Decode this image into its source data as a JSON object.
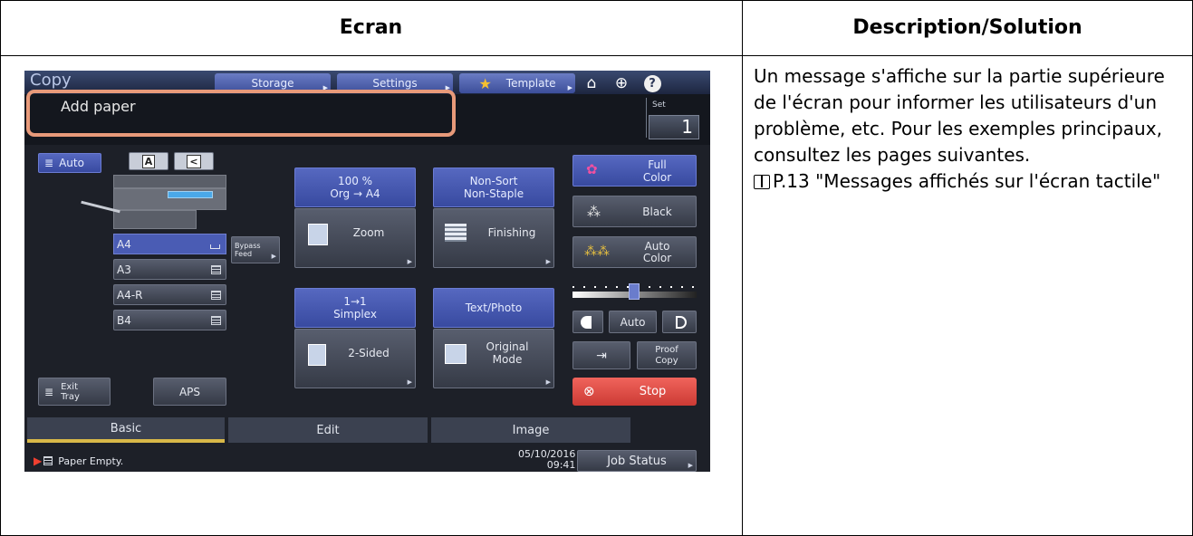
{
  "table": {
    "header_screen": "Ecran",
    "header_description": "Description/Solution",
    "description": "Un message s'affiche sur la partie supérieure de l'écran pour informer les utilisateurs d'un problème, etc. Pour les exemples principaux, consultez les pages suivantes.",
    "reference": "P.13 \"Messages affichés sur l'écran tactile\""
  },
  "screen": {
    "app_title": "Copy",
    "top_buttons": [
      "Storage",
      "Settings",
      "Template"
    ],
    "message": "Add paper",
    "set_label": "Set",
    "set_value": "1",
    "left": {
      "auto_label": "Auto",
      "trays": [
        "A4",
        "A3",
        "A4-R",
        "B4"
      ],
      "bypass_line1": "Bypass",
      "bypass_line2": "Feed",
      "exit_tray_line1": "Exit",
      "exit_tray_line2": "Tray",
      "aps": "APS"
    },
    "center": {
      "zoom_info_line1": "100 %",
      "zoom_info_line2": "Org  →   A4",
      "zoom": "Zoom",
      "finishing_info_line1": "Non-Sort",
      "finishing_info_line2": "Non-Staple",
      "finishing": "Finishing",
      "duplex_info_line1": "1→1",
      "duplex_info_line2": "Simplex",
      "two_sided": "2-Sided",
      "mode_info": "Text/Photo",
      "original_mode_line1": "Original",
      "original_mode_line2": "Mode"
    },
    "right": {
      "full_color_line1": "Full",
      "full_color_line2": "Color",
      "black": "Black",
      "auto_color_line1": "Auto",
      "auto_color_line2": "Color",
      "density_auto": "Auto",
      "proof_copy_line1": "Proof",
      "proof_copy_line2": "Copy",
      "stop": "Stop"
    },
    "tabs": [
      "Basic",
      "Edit",
      "Image"
    ],
    "status": {
      "message": "Paper Empty.",
      "date": "05/10/2016",
      "time": "09:41",
      "job_status": "Job Status"
    },
    "colors": {
      "accent_blue": "#4a5cb4",
      "highlight": "#e89a7a",
      "stop_red": "#e04840",
      "active_tab_underline": "#d8b848"
    }
  }
}
